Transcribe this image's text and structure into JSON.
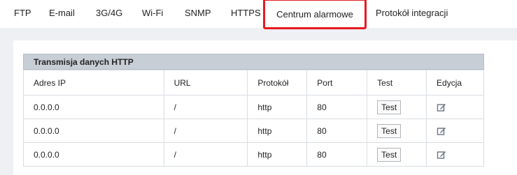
{
  "tabs": [
    {
      "label": "FTP"
    },
    {
      "label": "E-mail"
    },
    {
      "label": "3G/4G"
    },
    {
      "label": "Wi-Fi"
    },
    {
      "label": "SNMP"
    },
    {
      "label": "HTTPS"
    },
    {
      "label": "Centrum alarmowe"
    },
    {
      "label": "Protokół integracji"
    }
  ],
  "active_tab": "Centrum alarmowe",
  "colors": {
    "active_tab_border": "#e8191f",
    "header_bar": "#c8ced6",
    "background": "#eef0f4"
  },
  "section": {
    "title": "Transmisja danych HTTP"
  },
  "table": {
    "headers": [
      "Adres IP",
      "URL",
      "Protokół",
      "Port",
      "Test",
      "Edycja"
    ],
    "rows": [
      {
        "ip": "0.0.0.0",
        "url": "/",
        "protocol": "http",
        "port": "80",
        "test_label": "Test",
        "edit_icon": "edit-icon"
      },
      {
        "ip": "0.0.0.0",
        "url": "/",
        "protocol": "http",
        "port": "80",
        "test_label": "Test",
        "edit_icon": "edit-icon"
      },
      {
        "ip": "0.0.0.0",
        "url": "/",
        "protocol": "http",
        "port": "80",
        "test_label": "Test",
        "edit_icon": "edit-icon"
      }
    ]
  }
}
